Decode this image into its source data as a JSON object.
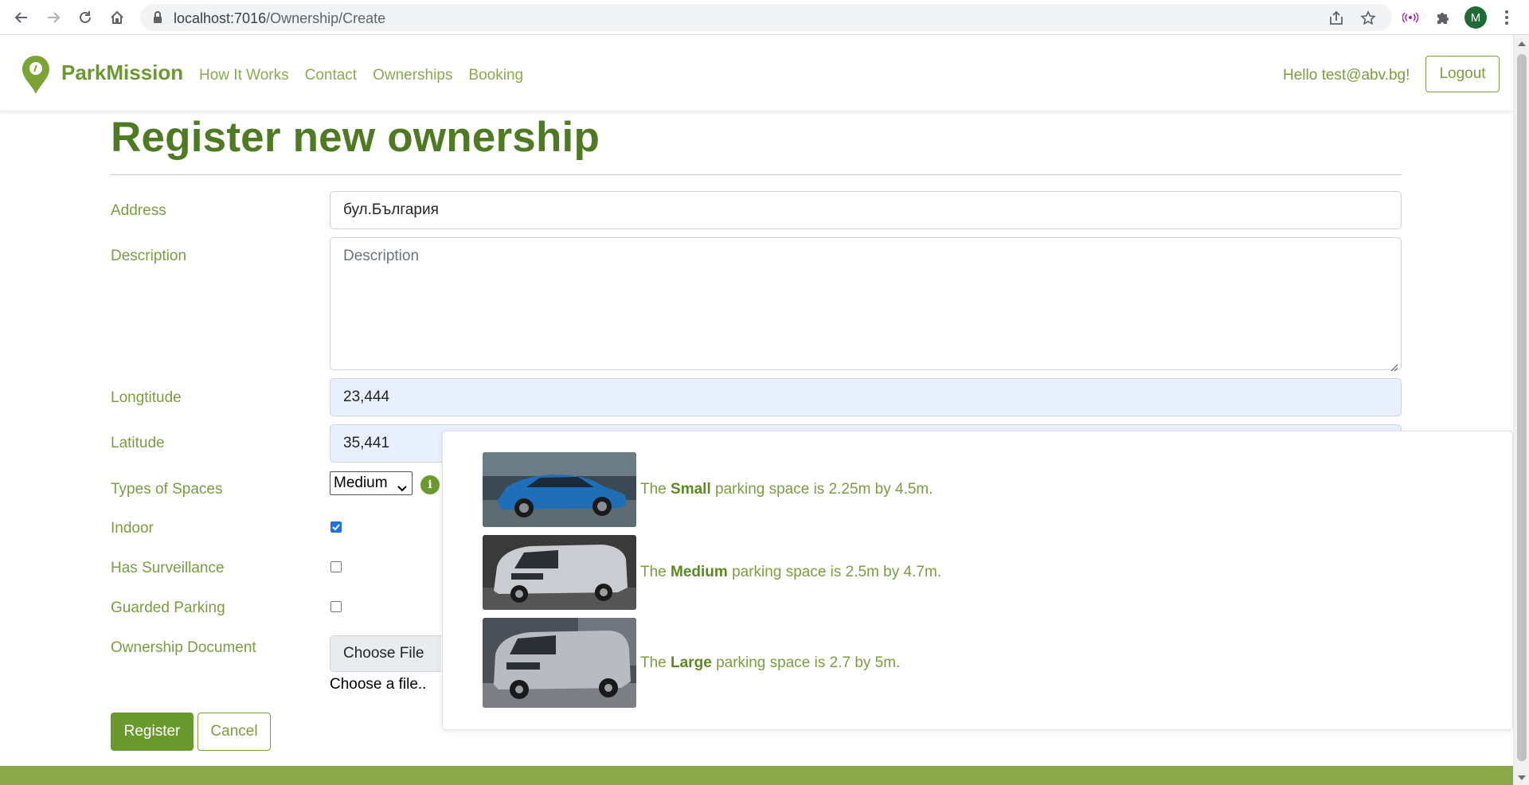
{
  "browser": {
    "url_host": "localhost:7016",
    "url_path": "/Ownership/Create",
    "profile_initial": "M"
  },
  "nav": {
    "brand": "ParkMission",
    "links": [
      "How It Works",
      "Contact",
      "Ownerships",
      "Booking"
    ],
    "greeting": "Hello test@abv.bg!",
    "logout": "Logout"
  },
  "page": {
    "title": "Register new ownership"
  },
  "form": {
    "address": {
      "label": "Address",
      "value": "бул.България"
    },
    "description": {
      "label": "Description",
      "placeholder": "Description",
      "value": ""
    },
    "longitude": {
      "label": "Longtitude",
      "value": "23,444"
    },
    "latitude": {
      "label": "Latitude",
      "value": "35,441"
    },
    "space_type": {
      "label": "Types of Spaces",
      "selected": "Medium"
    },
    "indoor": {
      "label": "Indoor",
      "checked": true
    },
    "surveillance": {
      "label": "Has Surveillance",
      "checked": false
    },
    "guarded": {
      "label": "Guarded Parking",
      "checked": false
    },
    "document": {
      "label": "Ownership Document",
      "button": "Choose File",
      "hint": "Choose a file.."
    },
    "register": "Register",
    "cancel": "Cancel"
  },
  "popover": {
    "rows": [
      {
        "prefix": "The",
        "size": "Small",
        "suffix": "parking space is 2.25m by 4.5m.",
        "car_color": "#1f6fb8"
      },
      {
        "prefix": "The",
        "size": "Medium",
        "suffix": "parking space is 2.5m by 4.7m.",
        "car_color": "#c9ccd0"
      },
      {
        "prefix": "The",
        "size": "Large",
        "suffix": "parking space is 2.7 by 5m.",
        "car_color": "#b8bcc2"
      }
    ]
  },
  "colors": {
    "brand_green": "#6a9a2e",
    "title_green": "#4e7a22",
    "label_green": "#7a9e3e",
    "footer_green": "#8aaa4a"
  },
  "icons": [
    "back-arrow-icon",
    "forward-arrow-icon",
    "reload-icon",
    "home-icon",
    "lock-icon",
    "share-icon",
    "star-icon",
    "cast-icon",
    "puzzle-icon",
    "info-icon",
    "location-pin-icon"
  ]
}
